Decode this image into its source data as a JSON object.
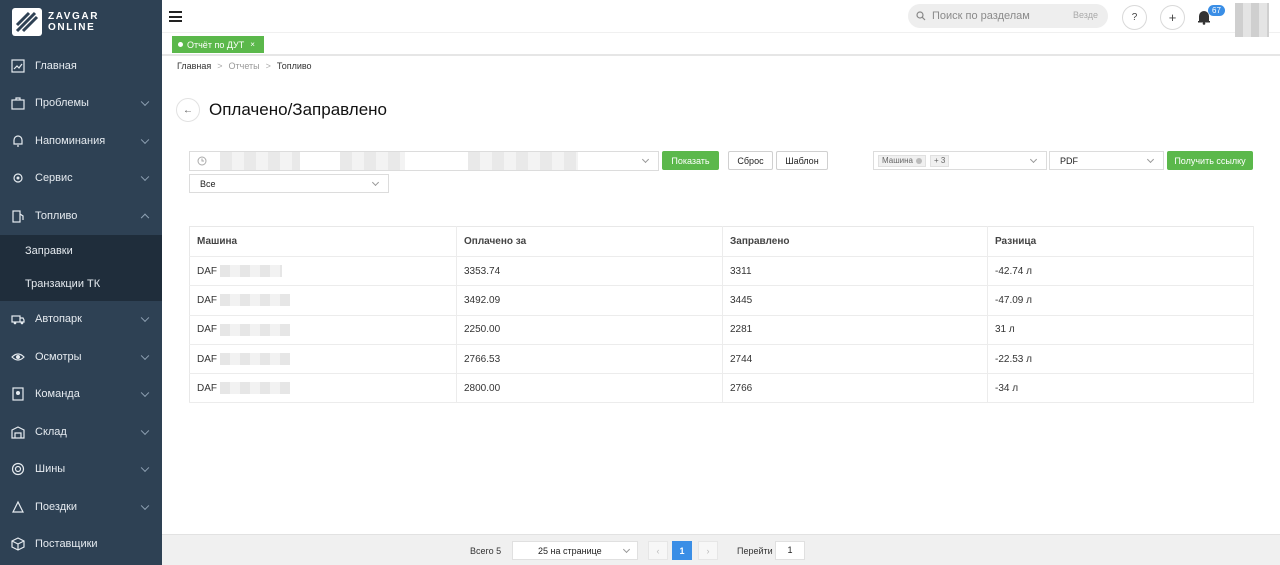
{
  "sidebar": {
    "logo": {
      "line1": "ZAVGAR",
      "line2": "ONLINE"
    },
    "items": [
      {
        "label": "Главная",
        "icon": "dashboard-icon"
      },
      {
        "label": "Проблемы",
        "icon": "problems-icon"
      },
      {
        "label": "Напоминания",
        "icon": "bell-icon"
      },
      {
        "label": "Сервис",
        "icon": "service-icon"
      },
      {
        "label": "Топливо",
        "icon": "fuel-icon"
      },
      {
        "label": "Автопарк",
        "icon": "truck-icon"
      },
      {
        "label": "Осмотры",
        "icon": "eye-icon"
      },
      {
        "label": "Команда",
        "icon": "team-icon"
      },
      {
        "label": "Склад",
        "icon": "warehouse-icon"
      },
      {
        "label": "Шины",
        "icon": "tire-icon"
      },
      {
        "label": "Поездки",
        "icon": "trips-icon"
      },
      {
        "label": "Поставщики",
        "icon": "suppliers-icon"
      }
    ],
    "fuel_sub": [
      {
        "label": "Заправки"
      },
      {
        "label": "Транзакции ТК"
      }
    ]
  },
  "header": {
    "search_placeholder": "Поиск по разделам",
    "search_scope": "Везде",
    "help_label": "?",
    "add_label": "+",
    "notifications_count": "67"
  },
  "tab": {
    "label": "Отчёт по ДУТ",
    "close": "×"
  },
  "breadcrumb": {
    "home": "Главная",
    "reports": "Отчеты",
    "current": "Топливо"
  },
  "page": {
    "back": "←",
    "title": "Оплачено/Заправлено"
  },
  "filters": {
    "show_label": "Показать",
    "reset_label": "Сброс",
    "template_label": "Шаблон",
    "vehicle_tag": "Машина",
    "vehicle_more": "+ 3",
    "format_value": "PDF",
    "get_link_label": "Получить ссылку",
    "status_value": "Все"
  },
  "table": {
    "headers": [
      "Машина",
      "Оплачено за",
      "Заправлено",
      "Разница"
    ],
    "rows": [
      {
        "vehicle": "DAF",
        "paid": "3353.74",
        "filled": "3311",
        "diff": "-42.74 л"
      },
      {
        "vehicle": "DAF",
        "paid": "3492.09",
        "filled": "3445",
        "diff": "-47.09 л"
      },
      {
        "vehicle": "DAF",
        "paid": "2250.00",
        "filled": "2281",
        "diff": "31 л"
      },
      {
        "vehicle": "DAF",
        "paid": "2766.53",
        "filled": "2744",
        "diff": "-22.53 л"
      },
      {
        "vehicle": "DAF",
        "paid": "2800.00",
        "filled": "2766",
        "diff": "-34 л"
      }
    ]
  },
  "pagination": {
    "total": "Всего 5",
    "per_page": "25 на странице",
    "prev": "‹",
    "current_page": "1",
    "next": "›",
    "goto_label": "Перейти",
    "goto_value": "1"
  },
  "colors": {
    "sidebar_bg": "#2e4154",
    "accent_green": "#5bb84b",
    "accent_blue": "#3a8ee6"
  }
}
